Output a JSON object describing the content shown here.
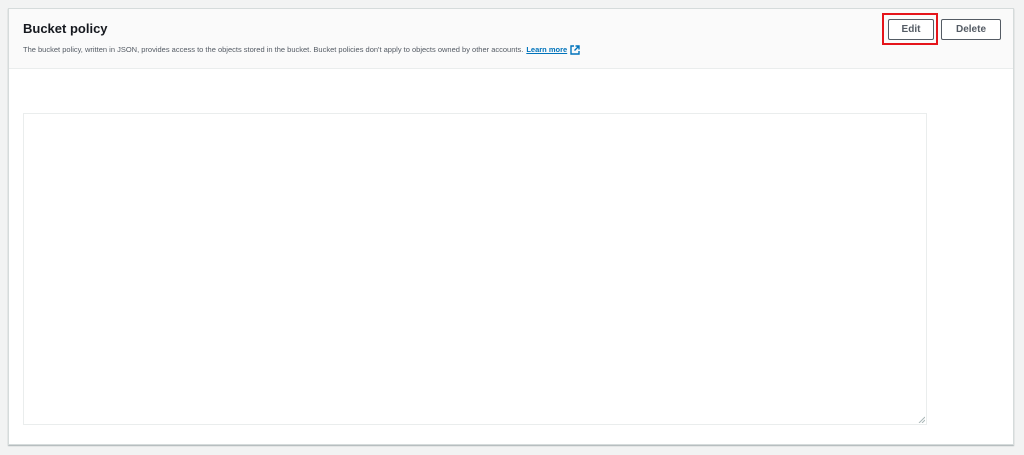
{
  "panel": {
    "title": "Bucket policy",
    "description": "The bucket policy, written in JSON, provides access to the objects stored in the bucket. Bucket policies don't apply to objects owned by other accounts.",
    "learn_more_label": "Learn more",
    "external_link_icon": "external-link-icon"
  },
  "actions": {
    "edit_label": "Edit",
    "delete_label": "Delete"
  },
  "editor": {
    "value": "",
    "resize_icon": "resize-grip-icon"
  },
  "colors": {
    "link": "#0073bb",
    "highlight": "#e5141a",
    "button_text": "#545b64"
  }
}
